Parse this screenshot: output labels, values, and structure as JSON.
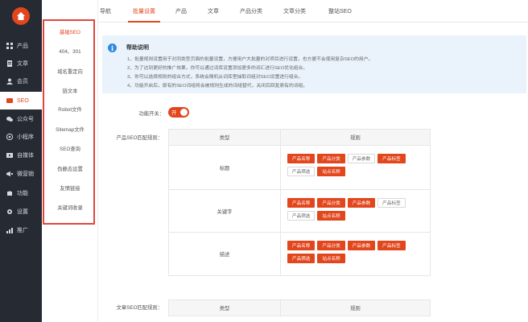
{
  "sidebar": {
    "items": [
      {
        "label": "产品",
        "icon": "grid-icon"
      },
      {
        "label": "文章",
        "icon": "document-icon"
      },
      {
        "label": "会员",
        "icon": "user-icon"
      },
      {
        "label": "SEO",
        "icon": "seo-icon",
        "active": true
      },
      {
        "label": "公众号",
        "icon": "wechat-icon"
      },
      {
        "label": "小程序",
        "icon": "mini-program-icon"
      },
      {
        "label": "自媒体",
        "icon": "media-icon"
      },
      {
        "label": "微营销",
        "icon": "marketing-icon"
      },
      {
        "label": "功能",
        "icon": "puzzle-icon"
      },
      {
        "label": "设置",
        "icon": "gear-icon"
      },
      {
        "label": "推广",
        "icon": "promote-icon"
      }
    ]
  },
  "subnav": {
    "items": [
      "基础SEO",
      "404、301",
      "域名重定向",
      "链文本",
      "Robot文件",
      "Sitemap文件",
      "SEO查询",
      "伪静态设置",
      "友情链接",
      "关键词收录"
    ]
  },
  "tabs": [
    "导航",
    "批量设置",
    "产品",
    "文章",
    "产品分类",
    "文章分类",
    "整站SEO"
  ],
  "help": {
    "title": "帮助说明",
    "lines": [
      "1、批量规则设置用于对同类型页面的批量设置，方便用户大批量的对项目进行设置，也方便不会使用复杂SEO的用户。",
      "2、为了达到更好的推广效果，你可以通过词库设置添加更多的词汇进行SEO优化组合。",
      "3、你可以选择规则的组合方式，系统会随机从词库里抽取词组对SEO设置进行组合。",
      "4、功能开启后，原有的SEO词组将会被规则生成的词组替代，关闭后回复原有的词组。"
    ]
  },
  "toggle": {
    "label": "功能开关：",
    "state": "开"
  },
  "product_rules": {
    "label": "产品SEO匹配规则：",
    "headers": [
      "类型",
      "规则"
    ],
    "rows": [
      {
        "name": "标题",
        "tags": [
          {
            "text": "产品名称",
            "on": true
          },
          {
            "text": "产品分类",
            "on": true
          },
          {
            "text": "产品参数",
            "on": false
          },
          {
            "text": "产品标签",
            "on": true
          },
          {
            "text": "产品筛选",
            "on": false
          },
          {
            "text": "站点名称",
            "on": true
          }
        ]
      },
      {
        "name": "关键字",
        "tags": [
          {
            "text": "产品名称",
            "on": true
          },
          {
            "text": "产品分类",
            "on": true
          },
          {
            "text": "产品参数",
            "on": true
          },
          {
            "text": "产品标签",
            "on": false
          },
          {
            "text": "产品筛选",
            "on": false
          },
          {
            "text": "站点名称",
            "on": true
          }
        ]
      },
      {
        "name": "描述",
        "tags": [
          {
            "text": "产品名称",
            "on": true
          },
          {
            "text": "产品分类",
            "on": true
          },
          {
            "text": "产品参数",
            "on": true
          },
          {
            "text": "产品标签",
            "on": true
          },
          {
            "text": "产品筛选",
            "on": true
          },
          {
            "text": "站点名称",
            "on": true
          }
        ]
      }
    ]
  },
  "article_rules": {
    "label": "文章SEO匹配规则：",
    "headers": [
      "类型",
      "规则"
    ]
  },
  "colors": {
    "accent": "#e2461d",
    "sidebar": "#262a33",
    "info": "#2f8ae0"
  }
}
